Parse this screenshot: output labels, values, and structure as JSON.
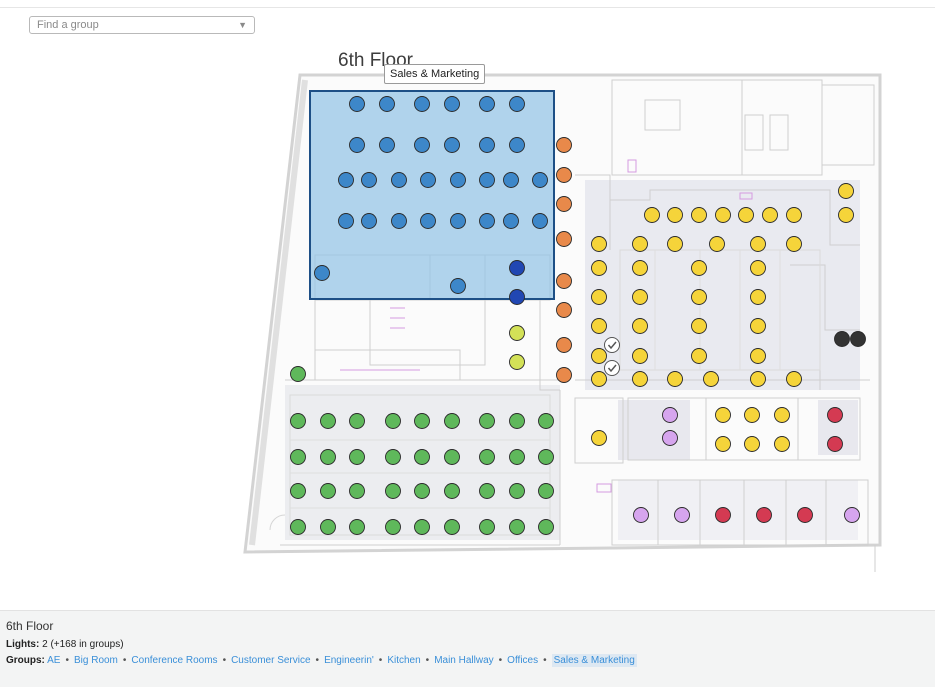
{
  "search": {
    "placeholder": "Find a group",
    "arrow": "▼"
  },
  "floor": {
    "title": "6th Floor"
  },
  "tooltip": {
    "label": "Sales & Marketing"
  },
  "panel": {
    "title": "6th Floor",
    "lights_label": "Lights:",
    "lights_value": "2 (+168 in groups)",
    "groups_label": "Groups:",
    "groups": [
      "AE",
      "Big Room",
      "Conference Rooms",
      "Customer Service",
      "Engineerin'",
      "Kitchen",
      "Main Hallway",
      "Offices",
      "Sales & Marketing"
    ],
    "active_group": "Sales & Marketing"
  },
  "colors": {
    "sales": "#3d87c9",
    "selected": "#2147b3",
    "orange": "#e8894a",
    "lime": "#d3e157",
    "yellow": "#f5d43a",
    "green": "#5fb85b",
    "purple": "#d6a5ee",
    "red": "#d43a52",
    "black": "#333333",
    "selection_fill": "#93c4e6",
    "selection_stroke": "#1d4f86"
  },
  "icons": {
    "check": "checkmark-icon",
    "dropdown": "chevron-down-icon"
  }
}
